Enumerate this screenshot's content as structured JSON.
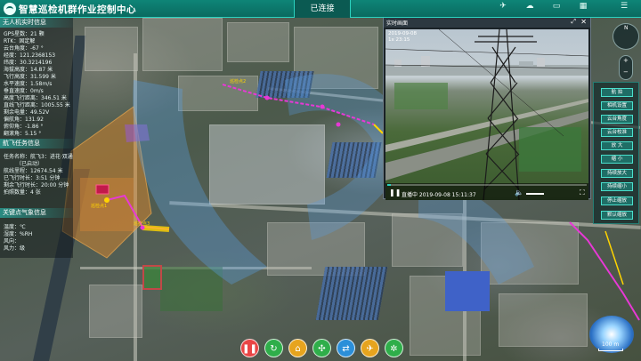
{
  "header": {
    "title": "智慧巡检机群作业控制中心",
    "connection_status": "已连接",
    "buttons": [
      {
        "label": "",
        "icon": "drone-icon"
      },
      {
        "label": "",
        "icon": "cloud-icon"
      },
      {
        "label": "",
        "icon": "monitor-icon"
      },
      {
        "label": "",
        "icon": "calendar-icon"
      },
      {
        "label": "",
        "icon": "menu-icon"
      }
    ]
  },
  "left_panel": {
    "drone_section_title": "无人机实时信息",
    "drone_info": [
      "GPS星数：21 颗",
      "RTK：固定解",
      "云台角度：-67 °",
      "经度：121.2368153",
      "纬度：30.3214196",
      "海拔高度：14.87 米",
      "飞行高度：31.599 米",
      "水平速度：1.58m/s",
      "垂直速度：0m/s",
      "高度飞行距离：346.51 米",
      "直线飞行距离：1005.55 米",
      "剩余电量：49.52V",
      "偏航角：131.92",
      "俯仰角：-1.86 °",
      "翻滚角：5.15 °"
    ],
    "task_section_title": "航飞任务信息",
    "task_info": [
      "任务名称：航飞3：进花·双通",
      "（已启动）",
      "航线里程：12674.54 米",
      "已飞行时长：3:51 分钟",
      "剩余飞行时长：20:00 分钟",
      "拍照数量：4 张"
    ],
    "weather_section_title": "关键点气象信息",
    "weather_info": [
      "温度：℃",
      "湿度：%RH",
      "风向：",
      "风力：级"
    ]
  },
  "video": {
    "title": "实时画面",
    "stamp_line1": "2019-09-08",
    "stamp_line2": "1x  23:15",
    "live_label": "直播中 2019-09-08 15:11:37",
    "progress": 0.02
  },
  "control_panel": {
    "buttons": [
      "航 拍",
      "相机设置",
      "云台角度",
      "云台校准",
      "放 大",
      "缩 小",
      "持续放大",
      "持续缩小",
      "停止缩放",
      "默认缩放"
    ]
  },
  "map": {
    "tags": [
      "巡检点1",
      "巡检点2",
      "巡检点3"
    ],
    "scale_label": "100 m"
  },
  "bottom_bar": {
    "actions": [
      {
        "icon": "pause-icon",
        "color": "#e84545"
      },
      {
        "icon": "return-icon",
        "color": "#2fae4a"
      },
      {
        "icon": "home-icon",
        "color": "#e6a41e"
      },
      {
        "icon": "target-icon",
        "color": "#2fae4a"
      },
      {
        "icon": "route-icon",
        "color": "#2b8fd9"
      },
      {
        "icon": "takeoff-icon",
        "color": "#e6a41e"
      },
      {
        "icon": "network-icon",
        "color": "#2fae4a"
      }
    ]
  },
  "colors": {
    "accent": "#2bd3c0",
    "header": "#0e8577",
    "route_yellow": "#ffd400",
    "route_magenta": "#e838d6"
  }
}
